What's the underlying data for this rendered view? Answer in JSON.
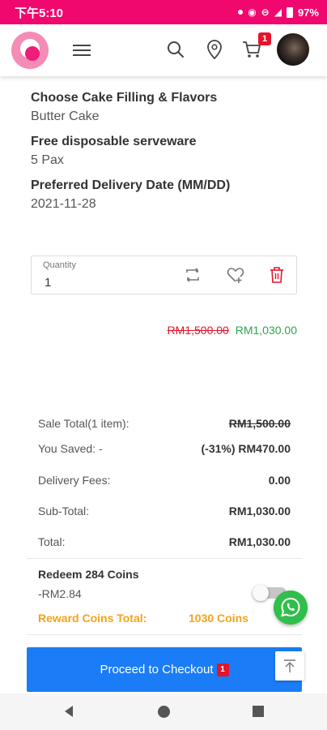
{
  "status_bar": {
    "time": "下午5:10",
    "battery": "97%"
  },
  "header": {
    "cart_count": "1",
    "icons": {
      "logo": "brand-logo",
      "menu": "hamburger-menu-icon",
      "search": "search-icon",
      "location": "location-pin-icon",
      "cart": "cart-icon",
      "avatar": "user-avatar"
    }
  },
  "options": [
    {
      "title": "Choose Cake Filling & Flavors",
      "value": "Butter Cake"
    },
    {
      "title": "Free disposable serveware",
      "value": "5 Pax"
    },
    {
      "title": "Preferred Delivery Date (MM/DD)",
      "value": "2021-11-28"
    }
  ],
  "quantity": {
    "label": "Quantity",
    "value": "1",
    "icons": [
      "refresh-icon",
      "add-to-wishlist-icon",
      "delete-icon"
    ]
  },
  "price": {
    "original": "RM1,500.00",
    "current": "RM1,030.00"
  },
  "summary": {
    "sale_total_label": "Sale Total(1 item):",
    "sale_total_value": "RM1,500.00",
    "you_saved_label": "You Saved: -",
    "you_saved_value": "(-31%) RM470.00",
    "delivery_label": "Delivery Fees:",
    "delivery_value": "0.00",
    "subtotal_label": "Sub-Total:",
    "subtotal_value": "RM1,030.00",
    "total_label": "Total:",
    "total_value": "RM1,030.00"
  },
  "redeem": {
    "title": "Redeem 284 Coins",
    "amount": "-RM2.84",
    "toggle_on": false,
    "reward_label": "Reward Coins Total:",
    "reward_value": "1030 Coins"
  },
  "checkout": {
    "label": "Proceed to Checkout",
    "badge": "1"
  },
  "colors": {
    "status_bar": "#f0086f",
    "checkout": "#1a7cf6",
    "strike_red": "#e4142b",
    "price_green": "#2ea44f",
    "reward_orange": "#f5a31a",
    "whatsapp_green": "#2fbf4a"
  }
}
